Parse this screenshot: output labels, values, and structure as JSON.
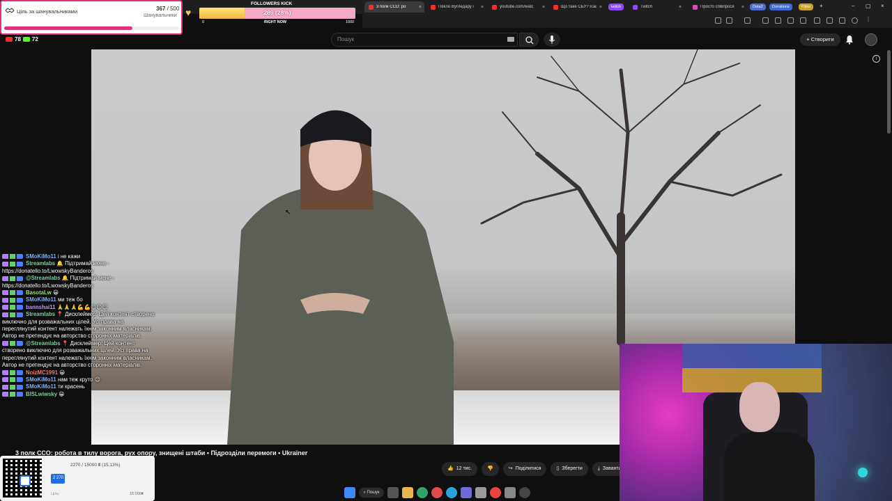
{
  "browser": {
    "tabs": [
      {
        "label": "3 полк ССО: ро",
        "active": true
      },
      {
        "label": "Пекло Вугледару і"
      },
      {
        "label": "youtube.com/watc"
      },
      {
        "label": "Що таке СБУ? Ісаш"
      },
      {
        "label": "Twitch"
      },
      {
        "label": "Просто співпрося"
      }
    ],
    "pills": [
      "twitch",
      "Dota2",
      "Donations",
      "Films"
    ]
  },
  "header": {
    "search_placeholder": "Пошук",
    "create_label": "Створити",
    "counter_left": "78",
    "counter_right": "72"
  },
  "goal_widget": {
    "title": "Ціль за шанувальниками",
    "count": "367",
    "total": "/ 500",
    "unit": "Шанувальники",
    "progress": 0.734
  },
  "kick_widget": {
    "title": "FOLLOWERS KICK",
    "value": "289 (28%)",
    "progress": 0.289,
    "min": "0",
    "now_label": "RIGHT NOW",
    "max": "1000"
  },
  "chat": {
    "lines": [
      {
        "user": "SMoKiMo11",
        "color": "#8ab4f8",
        "msg": "і не кажи"
      },
      {
        "user": "Streamlabs",
        "color": "#7fd4a5",
        "msg": "🔔 Підтримай мене - https://donatello.to/LwowskyBanderos"
      },
      {
        "user": "@Streamlabs",
        "color": "#7fd4a5",
        "msg": "🔔 Підтримай мене - https://donatello.to/LwowskyBanderos"
      },
      {
        "user": "BasotaLw",
        "color": "#9fe870",
        "msg": "😀"
      },
      {
        "user": "SMoKiMo11",
        "color": "#8ab4f8",
        "msg": "ми теж бо"
      },
      {
        "user": "bannshai11",
        "color": "#c79dff",
        "msg": "🙏🙏🙏💪💪😊😊😊"
      },
      {
        "user": "Streamlabs",
        "color": "#7fd4a5",
        "msg": "📍 Дисклеймер: Цей контент створено виключно для розважальних цілей. Усі права на переглянутий контент належать їхнім законним власникам. Автор не претендує на авторство сторонніх матеріалів."
      },
      {
        "user": "@Streamlabs",
        "color": "#7fd4a5",
        "msg": "📍 Дисклеймер: Цей контент створено виключно для розважальних цілей. Усі права на переглянутий контент належать їхнім законним власникам. Автор не претендує на авторство сторонніх матеріалів."
      },
      {
        "user": "NoizMC1991",
        "color": "#ff7a7a",
        "msg": "😀"
      },
      {
        "user": "SMoKiMo11",
        "color": "#8ab4f8",
        "msg": "нам теж круто 😊"
      },
      {
        "user": "SMoKiMo11",
        "color": "#8ab4f8",
        "msg": "ти красень"
      },
      {
        "user": "BISLwiwsky",
        "color": "#7fd4a5",
        "msg": "😀"
      }
    ]
  },
  "video": {
    "title": "3 полк ССО: робота в тилу ворога, рух опору, знищені штаби • Підрозділи перемоги • Ukraїner",
    "likes": "12 тис.",
    "share": "Поділитися",
    "save": "Зберегти",
    "download": "Завантажити"
  },
  "donation": {
    "text": "2270 / 15000 ₴ (15.13%)",
    "bar_value": "2 270",
    "progress": 0.1513,
    "goal_left": "Ціль:",
    "goal_right": "15 000₴"
  },
  "taskbar": {
    "search_label": "Пошук"
  },
  "colors": {
    "accent_pink": "#e4317d",
    "bar_gold": "#f3b73c",
    "donate_blue": "#1f6fe0"
  }
}
